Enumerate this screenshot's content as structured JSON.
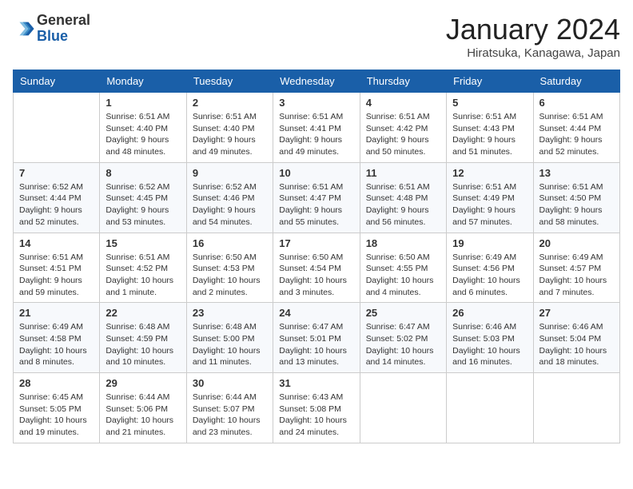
{
  "header": {
    "logo_line1": "General",
    "logo_line2": "Blue",
    "month": "January 2024",
    "location": "Hiratsuka, Kanagawa, Japan"
  },
  "days_of_week": [
    "Sunday",
    "Monday",
    "Tuesday",
    "Wednesday",
    "Thursday",
    "Friday",
    "Saturday"
  ],
  "weeks": [
    [
      {
        "day": "",
        "sunrise": "",
        "sunset": "",
        "daylight": ""
      },
      {
        "day": "1",
        "sunrise": "Sunrise: 6:51 AM",
        "sunset": "Sunset: 4:40 PM",
        "daylight": "Daylight: 9 hours and 48 minutes."
      },
      {
        "day": "2",
        "sunrise": "Sunrise: 6:51 AM",
        "sunset": "Sunset: 4:40 PM",
        "daylight": "Daylight: 9 hours and 49 minutes."
      },
      {
        "day": "3",
        "sunrise": "Sunrise: 6:51 AM",
        "sunset": "Sunset: 4:41 PM",
        "daylight": "Daylight: 9 hours and 49 minutes."
      },
      {
        "day": "4",
        "sunrise": "Sunrise: 6:51 AM",
        "sunset": "Sunset: 4:42 PM",
        "daylight": "Daylight: 9 hours and 50 minutes."
      },
      {
        "day": "5",
        "sunrise": "Sunrise: 6:51 AM",
        "sunset": "Sunset: 4:43 PM",
        "daylight": "Daylight: 9 hours and 51 minutes."
      },
      {
        "day": "6",
        "sunrise": "Sunrise: 6:51 AM",
        "sunset": "Sunset: 4:44 PM",
        "daylight": "Daylight: 9 hours and 52 minutes."
      }
    ],
    [
      {
        "day": "7",
        "sunrise": "Sunrise: 6:52 AM",
        "sunset": "Sunset: 4:44 PM",
        "daylight": "Daylight: 9 hours and 52 minutes."
      },
      {
        "day": "8",
        "sunrise": "Sunrise: 6:52 AM",
        "sunset": "Sunset: 4:45 PM",
        "daylight": "Daylight: 9 hours and 53 minutes."
      },
      {
        "day": "9",
        "sunrise": "Sunrise: 6:52 AM",
        "sunset": "Sunset: 4:46 PM",
        "daylight": "Daylight: 9 hours and 54 minutes."
      },
      {
        "day": "10",
        "sunrise": "Sunrise: 6:51 AM",
        "sunset": "Sunset: 4:47 PM",
        "daylight": "Daylight: 9 hours and 55 minutes."
      },
      {
        "day": "11",
        "sunrise": "Sunrise: 6:51 AM",
        "sunset": "Sunset: 4:48 PM",
        "daylight": "Daylight: 9 hours and 56 minutes."
      },
      {
        "day": "12",
        "sunrise": "Sunrise: 6:51 AM",
        "sunset": "Sunset: 4:49 PM",
        "daylight": "Daylight: 9 hours and 57 minutes."
      },
      {
        "day": "13",
        "sunrise": "Sunrise: 6:51 AM",
        "sunset": "Sunset: 4:50 PM",
        "daylight": "Daylight: 9 hours and 58 minutes."
      }
    ],
    [
      {
        "day": "14",
        "sunrise": "Sunrise: 6:51 AM",
        "sunset": "Sunset: 4:51 PM",
        "daylight": "Daylight: 9 hours and 59 minutes."
      },
      {
        "day": "15",
        "sunrise": "Sunrise: 6:51 AM",
        "sunset": "Sunset: 4:52 PM",
        "daylight": "Daylight: 10 hours and 1 minute."
      },
      {
        "day": "16",
        "sunrise": "Sunrise: 6:50 AM",
        "sunset": "Sunset: 4:53 PM",
        "daylight": "Daylight: 10 hours and 2 minutes."
      },
      {
        "day": "17",
        "sunrise": "Sunrise: 6:50 AM",
        "sunset": "Sunset: 4:54 PM",
        "daylight": "Daylight: 10 hours and 3 minutes."
      },
      {
        "day": "18",
        "sunrise": "Sunrise: 6:50 AM",
        "sunset": "Sunset: 4:55 PM",
        "daylight": "Daylight: 10 hours and 4 minutes."
      },
      {
        "day": "19",
        "sunrise": "Sunrise: 6:49 AM",
        "sunset": "Sunset: 4:56 PM",
        "daylight": "Daylight: 10 hours and 6 minutes."
      },
      {
        "day": "20",
        "sunrise": "Sunrise: 6:49 AM",
        "sunset": "Sunset: 4:57 PM",
        "daylight": "Daylight: 10 hours and 7 minutes."
      }
    ],
    [
      {
        "day": "21",
        "sunrise": "Sunrise: 6:49 AM",
        "sunset": "Sunset: 4:58 PM",
        "daylight": "Daylight: 10 hours and 8 minutes."
      },
      {
        "day": "22",
        "sunrise": "Sunrise: 6:48 AM",
        "sunset": "Sunset: 4:59 PM",
        "daylight": "Daylight: 10 hours and 10 minutes."
      },
      {
        "day": "23",
        "sunrise": "Sunrise: 6:48 AM",
        "sunset": "Sunset: 5:00 PM",
        "daylight": "Daylight: 10 hours and 11 minutes."
      },
      {
        "day": "24",
        "sunrise": "Sunrise: 6:47 AM",
        "sunset": "Sunset: 5:01 PM",
        "daylight": "Daylight: 10 hours and 13 minutes."
      },
      {
        "day": "25",
        "sunrise": "Sunrise: 6:47 AM",
        "sunset": "Sunset: 5:02 PM",
        "daylight": "Daylight: 10 hours and 14 minutes."
      },
      {
        "day": "26",
        "sunrise": "Sunrise: 6:46 AM",
        "sunset": "Sunset: 5:03 PM",
        "daylight": "Daylight: 10 hours and 16 minutes."
      },
      {
        "day": "27",
        "sunrise": "Sunrise: 6:46 AM",
        "sunset": "Sunset: 5:04 PM",
        "daylight": "Daylight: 10 hours and 18 minutes."
      }
    ],
    [
      {
        "day": "28",
        "sunrise": "Sunrise: 6:45 AM",
        "sunset": "Sunset: 5:05 PM",
        "daylight": "Daylight: 10 hours and 19 minutes."
      },
      {
        "day": "29",
        "sunrise": "Sunrise: 6:44 AM",
        "sunset": "Sunset: 5:06 PM",
        "daylight": "Daylight: 10 hours and 21 minutes."
      },
      {
        "day": "30",
        "sunrise": "Sunrise: 6:44 AM",
        "sunset": "Sunset: 5:07 PM",
        "daylight": "Daylight: 10 hours and 23 minutes."
      },
      {
        "day": "31",
        "sunrise": "Sunrise: 6:43 AM",
        "sunset": "Sunset: 5:08 PM",
        "daylight": "Daylight: 10 hours and 24 minutes."
      },
      {
        "day": "",
        "sunrise": "",
        "sunset": "",
        "daylight": ""
      },
      {
        "day": "",
        "sunrise": "",
        "sunset": "",
        "daylight": ""
      },
      {
        "day": "",
        "sunrise": "",
        "sunset": "",
        "daylight": ""
      }
    ]
  ]
}
